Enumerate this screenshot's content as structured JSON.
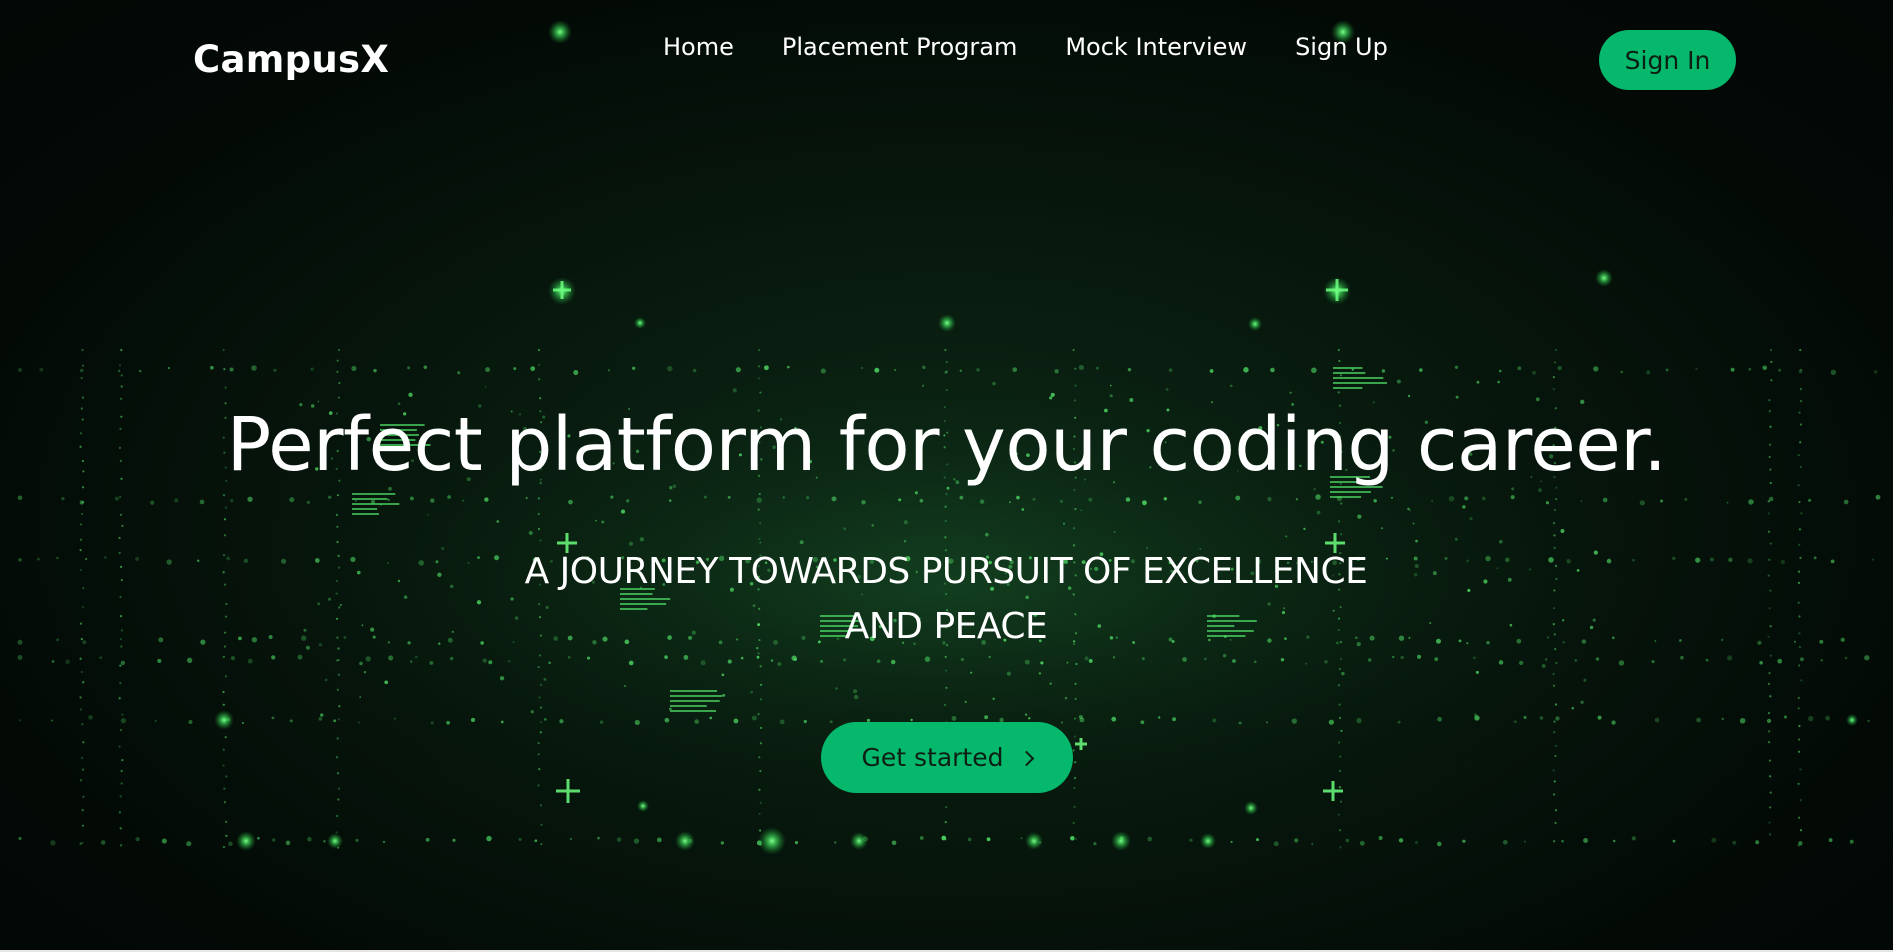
{
  "navbar": {
    "brand": "CampusX",
    "links": [
      {
        "label": "Home"
      },
      {
        "label": "Placement Program"
      },
      {
        "label": "Mock Interview"
      },
      {
        "label": "Sign Up"
      }
    ],
    "signin_label": "Sign In"
  },
  "hero": {
    "title": "Perfect platform for your coding career.",
    "subtitle": "A JOURNEY TOWARDS PURSUIT OF EXCELLENCE AND PEACE",
    "cta_label": "Get started",
    "cta_icon": "chevron-right-icon",
    "background": "green-matrix-dots"
  },
  "colors": {
    "accent": "#05b86b",
    "background": "#030a06",
    "glow": "#4cff6e",
    "text": "#ffffff"
  }
}
